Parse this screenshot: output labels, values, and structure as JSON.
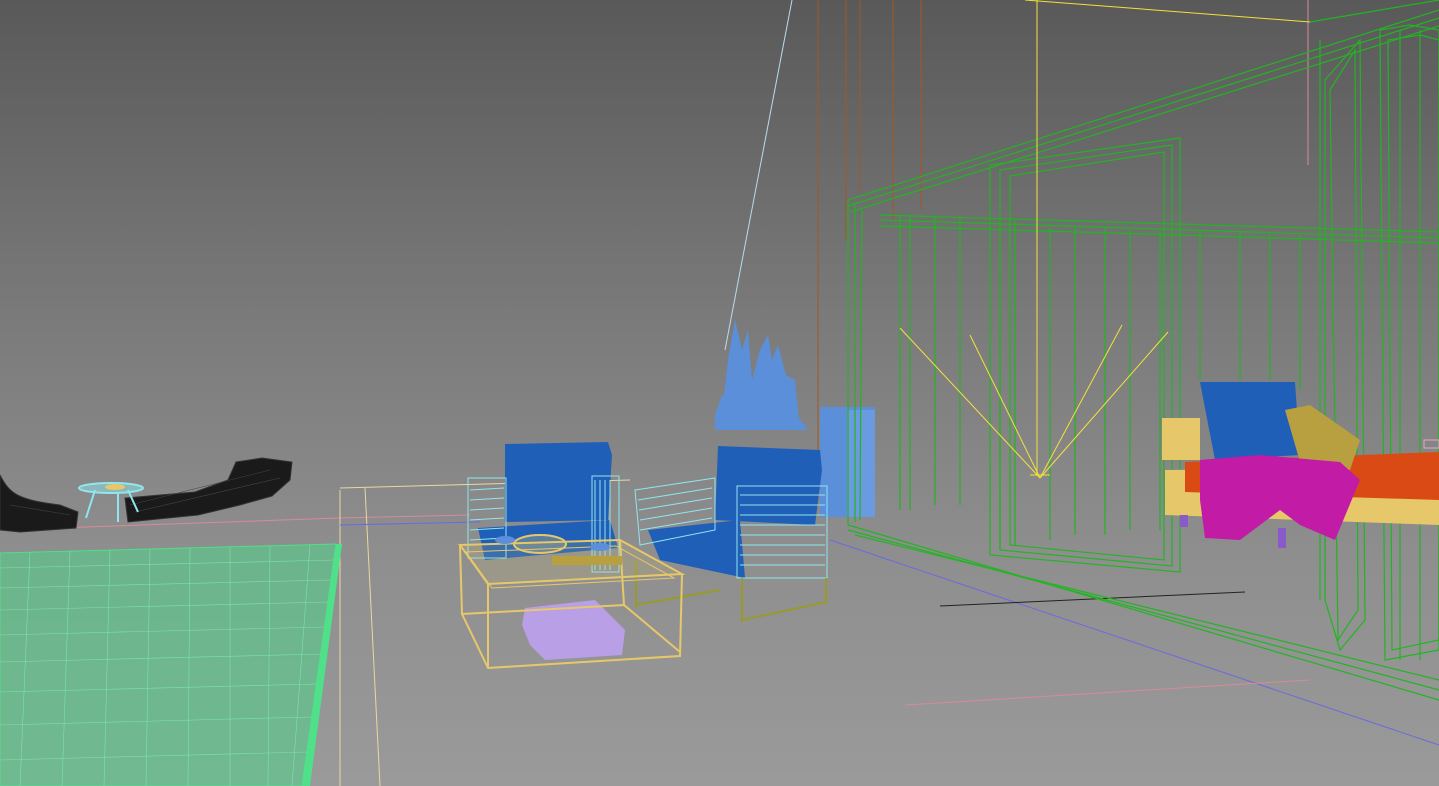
{
  "viewport": {
    "background_top": "#595959",
    "background_bottom": "#9a9a9a",
    "shading": "default-shading-with-wireframe"
  },
  "objects": [
    {
      "name": "pool-water",
      "color": "#4fe089",
      "icon": "pool-icon"
    },
    {
      "name": "sun-loungers",
      "color": "#1a1a1a",
      "icon": "lounger-icon"
    },
    {
      "name": "side-table-small",
      "color": "#8fe6ee",
      "icon": "table-icon"
    },
    {
      "name": "lounge-armchair-left",
      "color": "#1f5fb8",
      "icon": "chair-icon"
    },
    {
      "name": "lounge-armchair-right",
      "color": "#1f5fb8",
      "icon": "chair-icon"
    },
    {
      "name": "coffee-table",
      "color": "#e6c86a",
      "icon": "table-icon"
    },
    {
      "name": "throw-pillow-lilac",
      "color": "#b9a0e6",
      "icon": "cushion-icon"
    },
    {
      "name": "potted-plant",
      "color": "#5b8fd9",
      "icon": "plant-icon"
    },
    {
      "name": "glass-pavilion",
      "color": "#22b522",
      "icon": "frame-icon"
    },
    {
      "name": "outdoor-sofa",
      "color": "#d94a14",
      "icon": "sofa-icon"
    },
    {
      "name": "sofa-throw",
      "color": "#c21ca6",
      "icon": "blanket-icon"
    },
    {
      "name": "spot-light",
      "color": "#f2e23c",
      "icon": "light-icon"
    }
  ]
}
